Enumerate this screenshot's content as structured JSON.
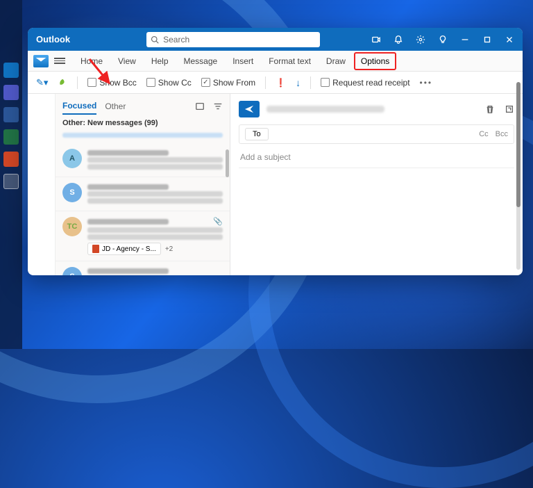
{
  "app": {
    "title": "Outlook"
  },
  "search": {
    "placeholder": "Search"
  },
  "tabs": {
    "home": "Home",
    "view": "View",
    "help": "Help",
    "message": "Message",
    "insert": "Insert",
    "format": "Format text",
    "draw": "Draw",
    "options": "Options"
  },
  "options_bar": {
    "show_bcc": "Show Bcc",
    "show_cc": "Show Cc",
    "show_from": "Show From",
    "read_receipt": "Request read receipt"
  },
  "list": {
    "tabs": {
      "focused": "Focused",
      "other": "Other"
    },
    "other_header": "Other: New messages (99)",
    "items": [
      {
        "avatar": "A",
        "class": "av-a"
      },
      {
        "avatar": "S",
        "class": "av-s"
      },
      {
        "avatar": "TC",
        "class": "av-tc",
        "attachment": "JD - Agency - S...",
        "more": "+2"
      },
      {
        "avatar": "S",
        "class": "av-s"
      }
    ]
  },
  "compose": {
    "to_label": "To",
    "cc": "Cc",
    "bcc": "Bcc",
    "subject_placeholder": "Add a subject"
  }
}
